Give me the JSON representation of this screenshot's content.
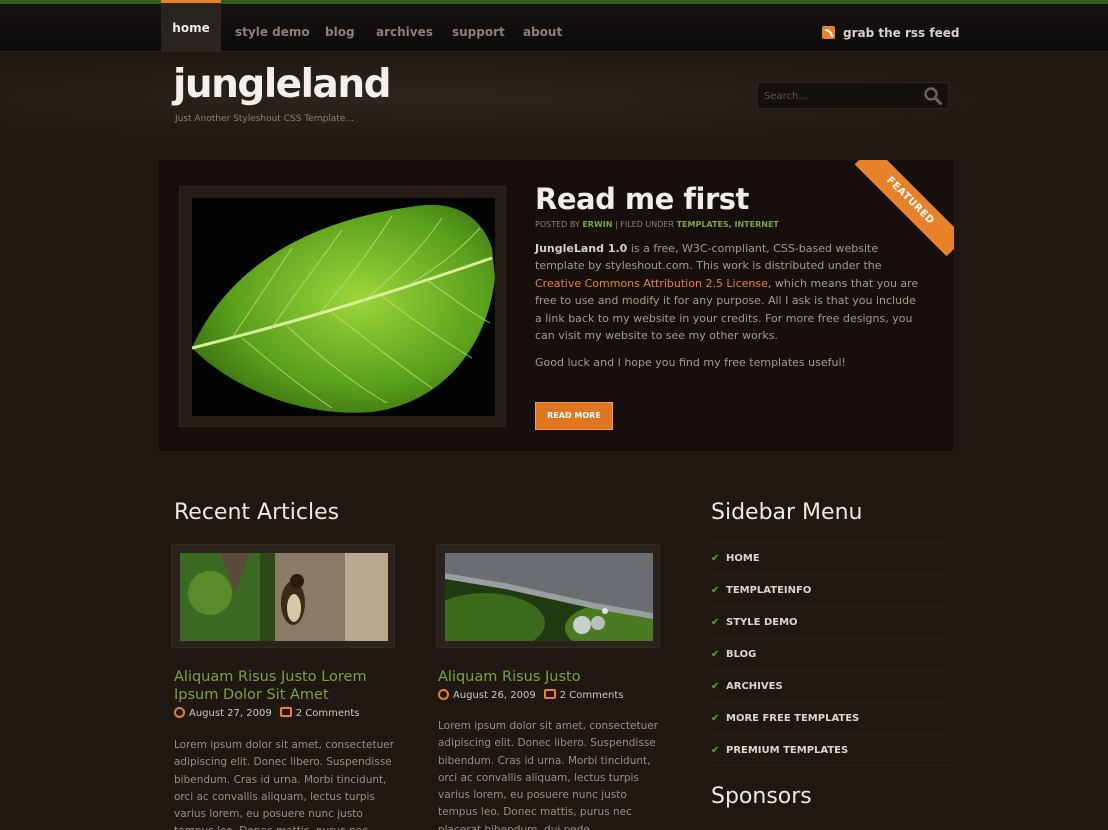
{
  "nav": {
    "items": [
      {
        "label": "home",
        "active": true
      },
      {
        "label": "style demo"
      },
      {
        "label": "blog"
      },
      {
        "label": "archives"
      },
      {
        "label": "support"
      },
      {
        "label": "about"
      }
    ],
    "rss_label": "grab the rss feed"
  },
  "header": {
    "title": "jungleland",
    "subtitle": "Just Another Styleshout CSS Template...",
    "search_placeholder": "Search..."
  },
  "featured": {
    "ribbon": "FEATURED",
    "title": "Read me first",
    "meta_posted": "POSTED BY",
    "meta_author": "ERWIN",
    "meta_filed": "| FILED UNDER",
    "meta_cats": "TEMPLATES, INTERNET",
    "text_strong": "JungleLand 1.0",
    "text_a": " is a free, W3C-compliant, CSS-based website template by styleshout.com. This work is distributed under the ",
    "text_link": "Creative Commons Attribution 2.5 License",
    "text_b": ", which means that you are free to use and modify it for any purpose. All I ask is that you include a link back to my website in your credits. For more free designs, you can visit my website to see my other works.",
    "text2": "Good luck and I hope you find my free templates useful!",
    "read_more": "READ MORE"
  },
  "recent": {
    "title": "Recent Articles",
    "articles": [
      {
        "title": "Aliquam Risus Justo Lorem Ipsum Dolor Sit Amet",
        "date": "August 27, 2009",
        "comments": "2 Comments",
        "text": "Lorem ipsum dolor sit amet, consectetuer adipiscing elit. Donec libero. Suspendisse bibendum. Cras id urna. Morbi tincidunt, orci ac convallis aliquam, lectus turpis varius lorem, eu posuere nunc justo tempus leo. Donec mattis, purus nec"
      },
      {
        "title": "Aliquam Risus Justo",
        "date": "August 26, 2009",
        "comments": "2 Comments",
        "text": "Lorem ipsum dolor sit amet, consectetuer adipiscing elit. Donec libero. Suspendisse bibendum. Cras id urna. Morbi tincidunt, orci ac convallis aliquam, lectus turpis varius lorem, eu posuere nunc justo tempus leo. Donec mattis, purus nec placerat bibendum, dui pede condimentum"
      }
    ]
  },
  "sidebar": {
    "title": "Sidebar Menu",
    "items": [
      "HOME",
      "TEMPLATEINFO",
      "STYLE DEMO",
      "BLOG",
      "ARCHIVES",
      "MORE FREE TEMPLATES",
      "PREMIUM TEMPLATES"
    ],
    "sponsors_title": "Sponsors"
  },
  "colors": {
    "accent": "#e8822a",
    "link_green": "#7fa33a",
    "background": "#1e1712"
  }
}
